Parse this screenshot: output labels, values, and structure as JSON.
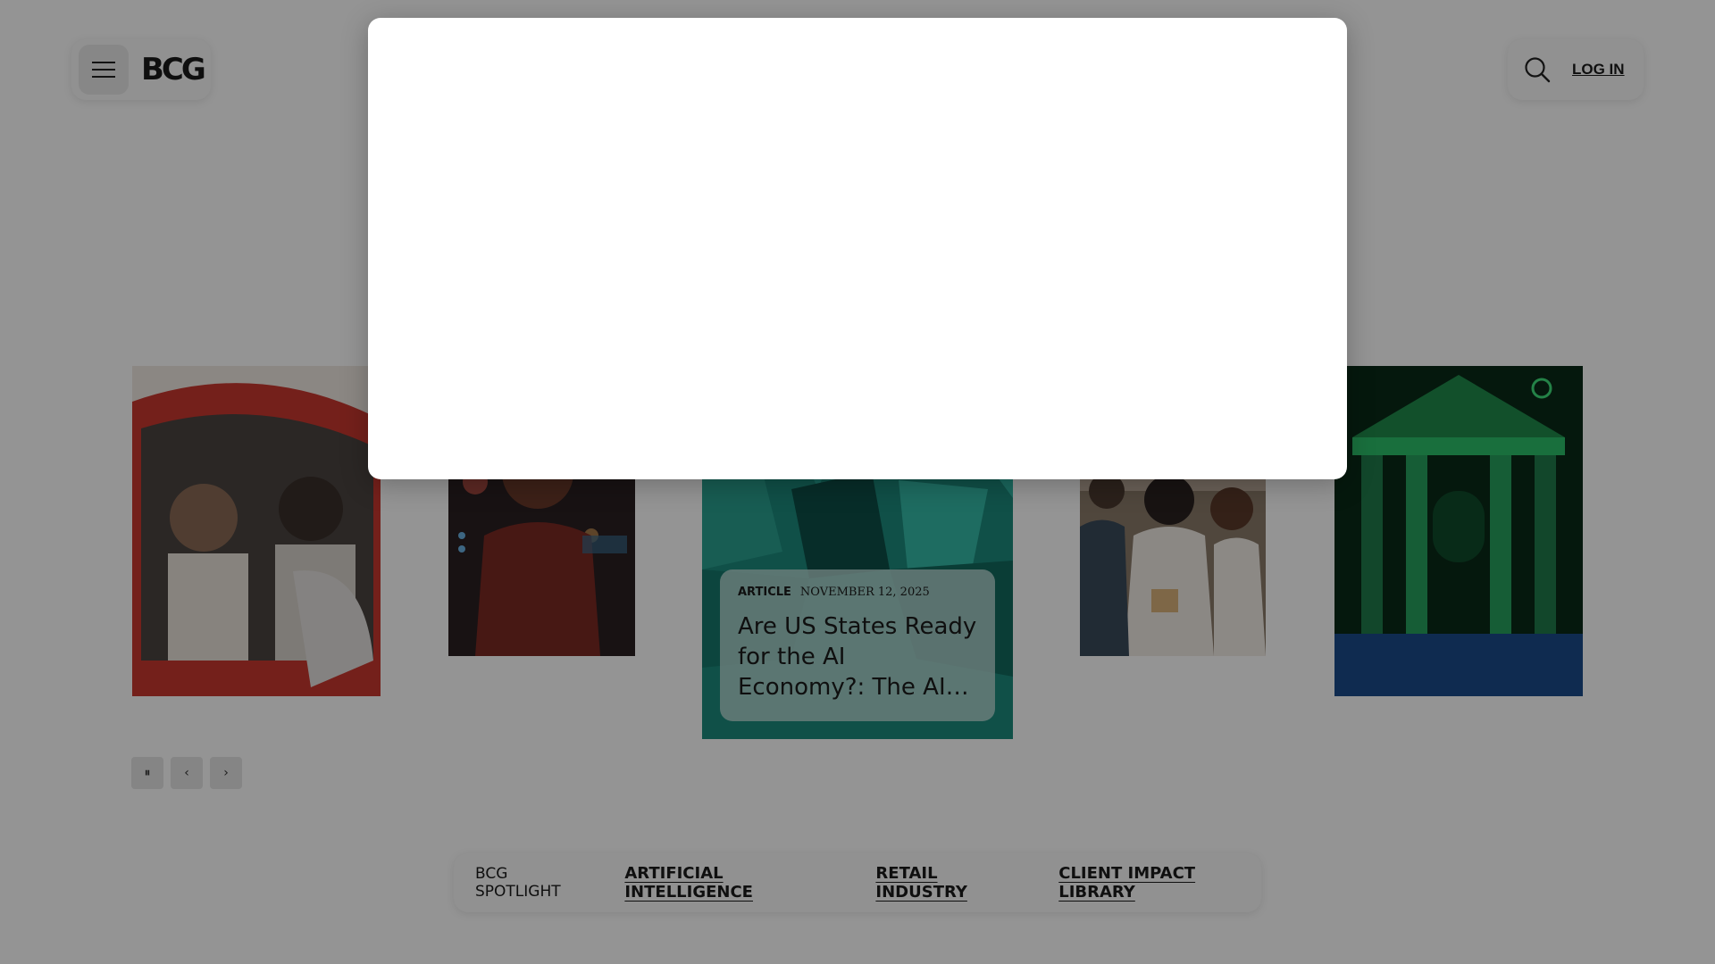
{
  "header": {
    "logo": "BCG",
    "menu_icon": "hamburger-menu-icon",
    "search_icon": "search-icon",
    "login_label": "LOG IN"
  },
  "carousel": {
    "feature": {
      "type": "ARTICLE",
      "date": "NOVEMBER 12, 2025",
      "title": "Are US States Ready for the AI Economy?: The AI Maturity…"
    },
    "controls": {
      "pause_label": "⏸",
      "prev_label": "‹",
      "next_label": "›"
    }
  },
  "spotlight": {
    "label": "BCG SPOTLIGHT",
    "links": [
      "ARTIFICIAL INTELLIGENCE",
      "RETAIL INDUSTRY",
      "CLIENT IMPACT LIBRARY"
    ]
  },
  "colors": {
    "overlay": "#000000",
    "feature_teal": "#1f8f80",
    "building_green": "#2bbf6a"
  }
}
